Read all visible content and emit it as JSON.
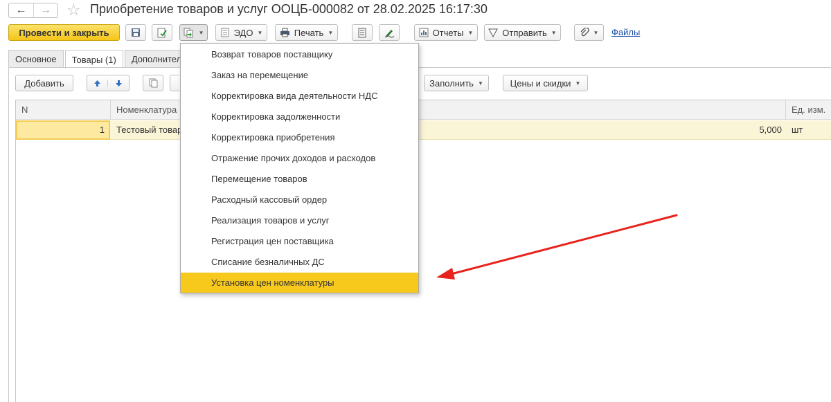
{
  "window": {
    "title": "Приобретение товаров и услуг ООЦБ-000082 от 28.02.2025 16:17:30",
    "back_icon": "arrow-left-icon",
    "forward_icon": "arrow-right-icon",
    "favorite_icon": "star-icon"
  },
  "toolbar": {
    "post_close_label": "Провести и закрыть",
    "edo_label": "ЭДО",
    "print_label": "Печать",
    "reports_label": "Отчеты",
    "send_label": "Отправить",
    "files_label": "Файлы"
  },
  "tabs": [
    {
      "label": "Основное",
      "active": false
    },
    {
      "label": "Товары (1)",
      "active": true
    },
    {
      "label": "Дополнитель",
      "active": false
    }
  ],
  "goods_toolbar": {
    "add_label": "Добавить",
    "fill_label": "Заполнить",
    "prices_label": "Цены и скидки"
  },
  "table": {
    "columns": [
      "N",
      "Номенклатура",
      "Ед. изм."
    ],
    "rows": [
      {
        "n": "1",
        "nomenclature": "Тестовый товар",
        "quantity": "5,000",
        "unit": "шт"
      }
    ]
  },
  "create_based_menu": {
    "items": [
      "Возврат товаров поставщику",
      "Заказ на перемещение",
      "Корректировка вида деятельности НДС",
      "Корректировка задолженности",
      "Корректировка приобретения",
      "Отражение прочих доходов и расходов",
      "Перемещение товаров",
      "Расходный кассовый ордер",
      "Реализация товаров и услуг",
      "Регистрация цен поставщика",
      "Списание безналичных ДС",
      "Установка цен номенклатуры"
    ],
    "highlighted_index": 11
  },
  "colors": {
    "accent_yellow": "#f8c91d",
    "row_highlight": "#fbf5d8",
    "link_blue": "#1a4da8",
    "annotation_red": "#e8221c"
  }
}
